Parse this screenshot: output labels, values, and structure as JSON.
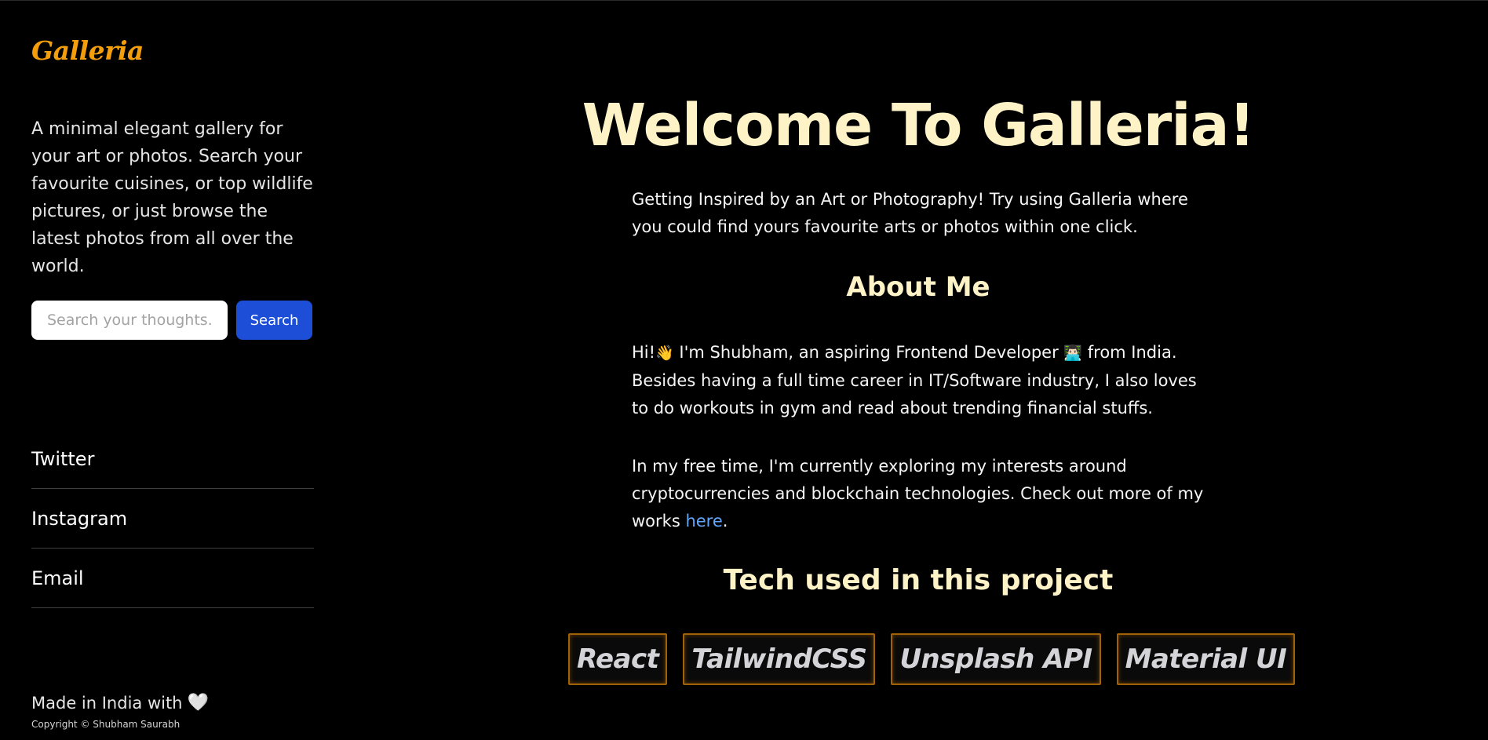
{
  "sidebar": {
    "logo": "Galleria",
    "tagline": "A minimal elegant gallery for your art or photos. Search your favourite cuisines, or top wildlife pictures, or just browse the latest photos from all over the world.",
    "search": {
      "placeholder": "Search your thoughts...",
      "value": "",
      "button_label": "Search"
    },
    "social_links": [
      {
        "label": "Twitter"
      },
      {
        "label": "Instagram"
      },
      {
        "label": "Email"
      }
    ],
    "footer": {
      "made_in": "Made in India with",
      "heart": "🤍",
      "copyright": "Copyright © Shubham Saurabh"
    }
  },
  "main": {
    "title": "Welcome To Galleria!",
    "intro": "Getting Inspired by an Art or Photography! Try using Galleria where you could find yours favourite arts or photos within one click.",
    "about": {
      "title": "About Me",
      "p1_start": "Hi!",
      "wave_emoji": "👋",
      "p1_mid": " I'm Shubham, an aspiring Frontend Developer ",
      "dev_emoji": "👨🏻‍💻",
      "p1_end": " from India. Besides having a full time career in IT/Software industry, I also loves to do workouts in gym and read about trending financial stuffs.",
      "p2_start": "In my free time, I'm currently exploring my interests around cryptocurrencies and blockchain technologies. Check out more of my works ",
      "p2_link": "here",
      "p2_end": "."
    },
    "tech": {
      "title": "Tech used in this project",
      "items": [
        {
          "label": "React"
        },
        {
          "label": "TailwindCSS"
        },
        {
          "label": "Unsplash API"
        },
        {
          "label": "Material UI"
        }
      ]
    }
  },
  "colors": {
    "background": "#000000",
    "logo": "#f59e0b",
    "heading": "#fef3c7",
    "button": "#1d4ed8",
    "link": "#60a5fa",
    "badge_border": "#a16207"
  }
}
